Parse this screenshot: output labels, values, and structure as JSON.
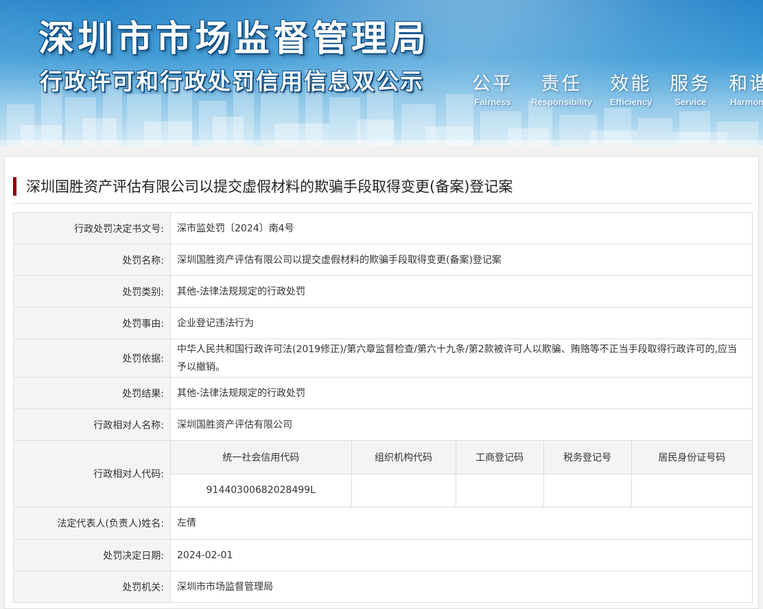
{
  "banner": {
    "title_main": "深圳市市场监督管理局",
    "title_sub": "行政许可和行政处罚信用信息双公示",
    "slogans": [
      {
        "cn": "公平",
        "en": "Fairness"
      },
      {
        "cn": "责任",
        "en": "Responsibility"
      },
      {
        "cn": "效能",
        "en": "Efficiency"
      },
      {
        "cn": "服务",
        "en": "Service"
      },
      {
        "cn": "和谐",
        "en": "Harmony"
      }
    ]
  },
  "case": {
    "title": "深圳国胜资产评估有限公司以提交虚假材料的欺骗手段取得变更(备案)登记案"
  },
  "fields": {
    "decision_no": {
      "label": "行政处罚决定书文号:",
      "value": "深市监处罚〔2024〕南4号"
    },
    "name": {
      "label": "处罚名称:",
      "value": "深圳国胜资产评估有限公司以提交虚假材料的欺骗手段取得变更(备案)登记案"
    },
    "category": {
      "label": "处罚类别:",
      "value": "其他-法律法规规定的行政处罚"
    },
    "reason": {
      "label": "处罚事由:",
      "value": "企业登记违法行为"
    },
    "basis": {
      "label": "处罚依据:",
      "value": "中华人民共和国行政许可法(2019修正)/第六章监督检查/第六十九条/第2款被许可人以欺骗、贿赂等不正当手段取得行政许可的,应当予以撤销。"
    },
    "result": {
      "label": "处罚结果:",
      "value": "其他-法律法规规定的行政处罚"
    },
    "party_name": {
      "label": "行政相对人名称:",
      "value": "深圳国胜资产评估有限公司"
    },
    "party_code": {
      "label": "行政相对人代码:",
      "headers": [
        "统一社会信用代码",
        "组织机构代码",
        "工商登记码",
        "税务登记号",
        "居民身份证号码"
      ],
      "values": [
        "91440300682028499L",
        "",
        "",
        "",
        ""
      ]
    },
    "legal_rep": {
      "label": "法定代表人(负责人)姓名:",
      "value": "左倩"
    },
    "decision_date": {
      "label": "处罚决定日期:",
      "value": "2024-02-01"
    },
    "authority": {
      "label": "处罚机关:",
      "value": "深圳市市场监督管理局"
    }
  }
}
